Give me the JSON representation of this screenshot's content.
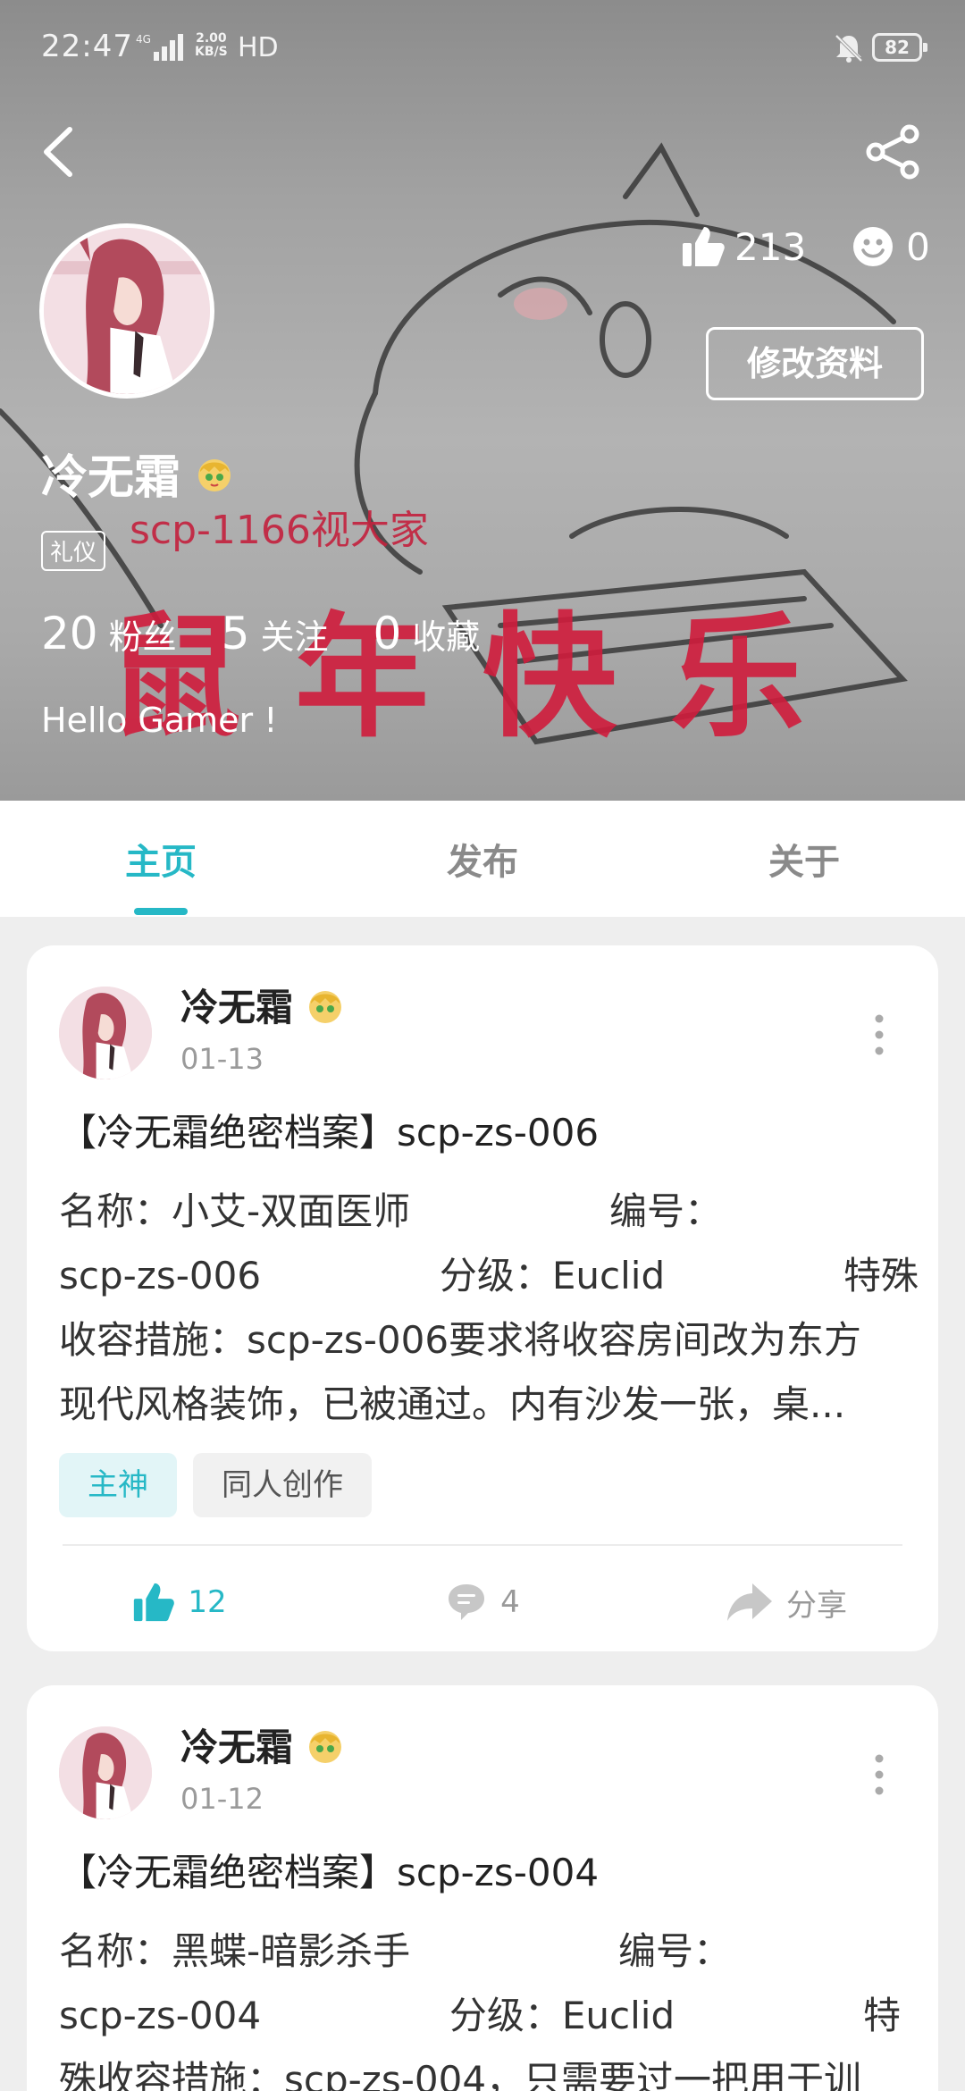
{
  "status_bar": {
    "time": "22:47",
    "net_speed_top": "2.00",
    "net_speed_bottom": "KB/S",
    "hd": "HD",
    "battery": "82"
  },
  "profile": {
    "name": "冷无霜",
    "title_tag": "礼仪",
    "likes": "213",
    "smiles": "0",
    "edit_label": "修改资料",
    "stats": [
      {
        "num": "20",
        "label": "粉丝"
      },
      {
        "num": "5",
        "label": "关注"
      },
      {
        "num": "0",
        "label": "收藏"
      }
    ],
    "bio": "Hello Gamer !",
    "banner_text_small": "scp-1166视大家",
    "banner_text_big": "鼠年快乐"
  },
  "tabs": [
    {
      "label": "主页",
      "active": true
    },
    {
      "label": "发布",
      "active": false
    },
    {
      "label": "关于",
      "active": false
    }
  ],
  "posts": [
    {
      "author": "冷无霜",
      "date": "01-13",
      "title": "【冷无霜绝密档案】scp-zs-006",
      "lines": [
        [
          "名称：小艾-双面医师",
          "编号："
        ],
        [
          "scp-zs-006",
          "分级：Euclid",
          "特殊"
        ],
        [
          "收容措施：scp-zs-006要求将收容房间改为东方"
        ],
        [
          "现代风格装饰，已被通过。内有沙发一张，桌..."
        ]
      ],
      "tags": [
        "主神",
        "同人创作"
      ],
      "likes": "12",
      "comments": "4",
      "share_label": "分享"
    },
    {
      "author": "冷无霜",
      "date": "01-12",
      "title": "【冷无霜绝密档案】scp-zs-004",
      "lines": [
        [
          "名称：黑蝶-暗影杀手",
          "编号："
        ],
        [
          "scp-zs-004",
          "分级：Euclid",
          "特"
        ],
        [
          "殊收容措施：scp-zs-004，只需要过一把用于训"
        ]
      ]
    }
  ],
  "colors": {
    "accent": "#26b8c6",
    "banner_red": "#d01c3c"
  }
}
